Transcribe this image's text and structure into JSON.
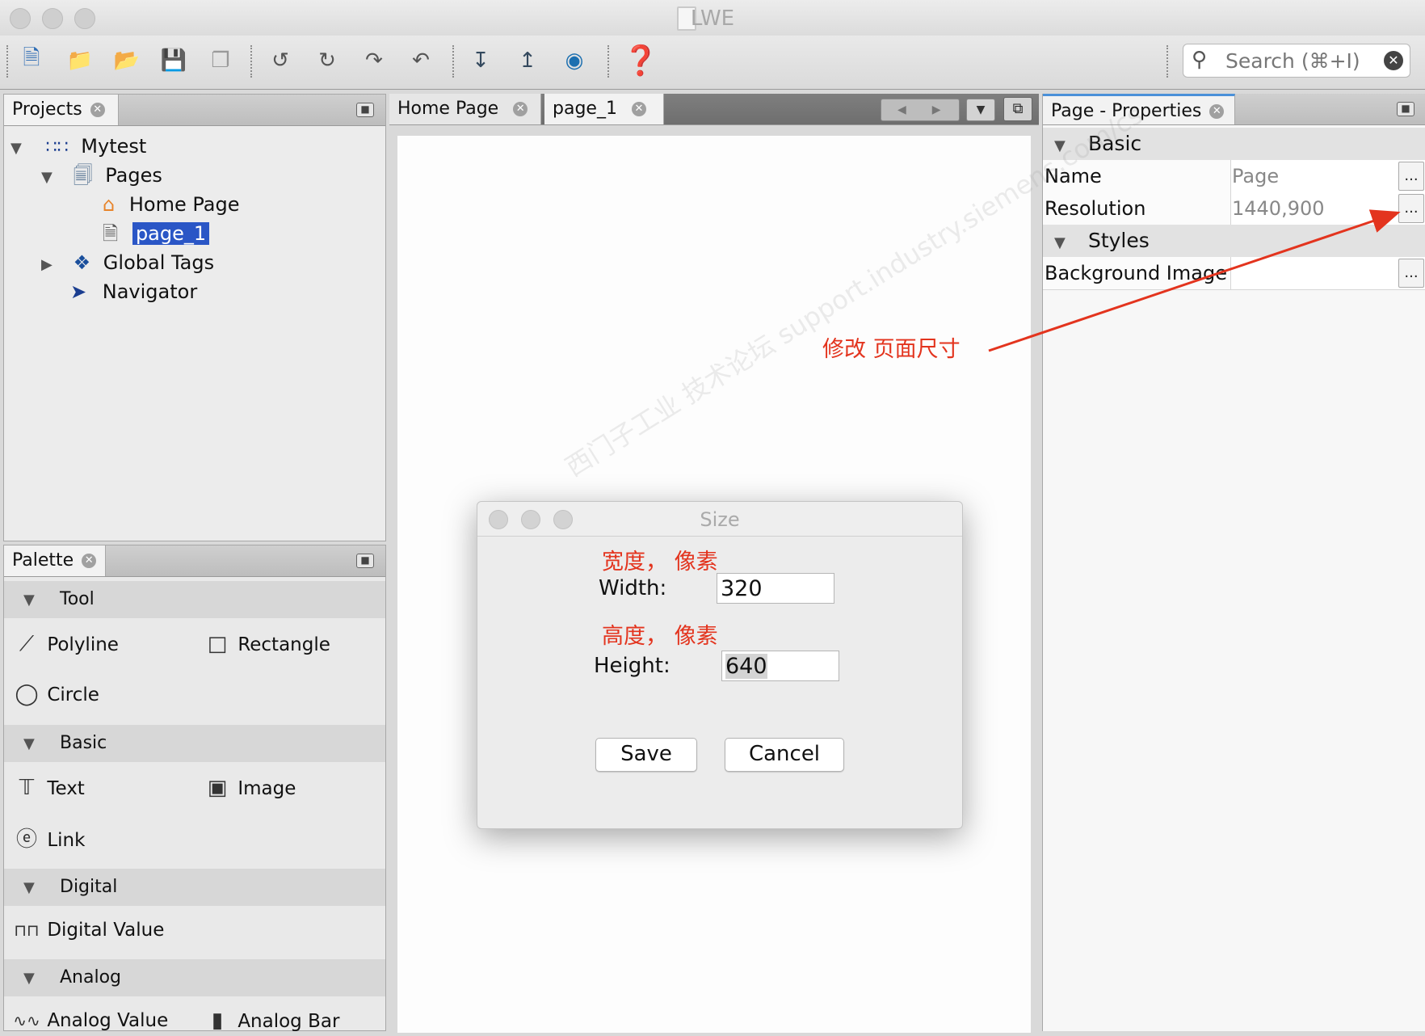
{
  "window": {
    "title": "LWE"
  },
  "toolbar": {
    "search_placeholder": "Search (⌘+I)",
    "search_icon": "search-icon"
  },
  "projects": {
    "tab_label": "Projects",
    "tree": [
      {
        "label": "Mytest",
        "icon": "project-icon"
      },
      {
        "label": "Pages",
        "icon": "pages-icon"
      },
      {
        "label": "Home Page",
        "icon": "home-icon"
      },
      {
        "label": "page_1",
        "icon": "page-icon",
        "selected": true
      },
      {
        "label": "Global Tags",
        "icon": "tags-icon"
      },
      {
        "label": "Navigator",
        "icon": "navigator-icon"
      }
    ]
  },
  "palette": {
    "tab_label": "Palette",
    "categories": [
      {
        "label": "Tool",
        "items": [
          "Polyline",
          "Rectangle",
          "Circle"
        ]
      },
      {
        "label": "Basic",
        "items": [
          "Text",
          "Image",
          "Link"
        ]
      },
      {
        "label": "Digital",
        "items": [
          "Digital Value"
        ]
      },
      {
        "label": "Analog",
        "items": [
          "Analog Value",
          "Analog Bar"
        ]
      }
    ]
  },
  "editor": {
    "tabs": [
      {
        "label": "Home Page"
      },
      {
        "label": "page_1"
      }
    ]
  },
  "properties": {
    "tab_label": "Page - Properties",
    "sections": [
      {
        "label": "Basic",
        "rows": [
          {
            "name": "Name",
            "value": "Page"
          },
          {
            "name": "Resolution",
            "value": "1440,900"
          }
        ]
      },
      {
        "label": "Styles",
        "rows": [
          {
            "name": "Background Image",
            "value": ""
          }
        ]
      }
    ],
    "ellipsis": "..."
  },
  "annotation": {
    "resize_note": "修改 页面尺寸",
    "width_note": "宽度， 像素",
    "height_note": "高度， 像素",
    "arrow_color": "#e3341e"
  },
  "dialog": {
    "title": "Size",
    "width_label": "Width:",
    "width_value": "320",
    "height_label": "Height:",
    "height_value": "640",
    "save_label": "Save",
    "cancel_label": "Cancel"
  },
  "watermark": "西门子工业 技术论坛 support.industry.siemens.com/cs"
}
